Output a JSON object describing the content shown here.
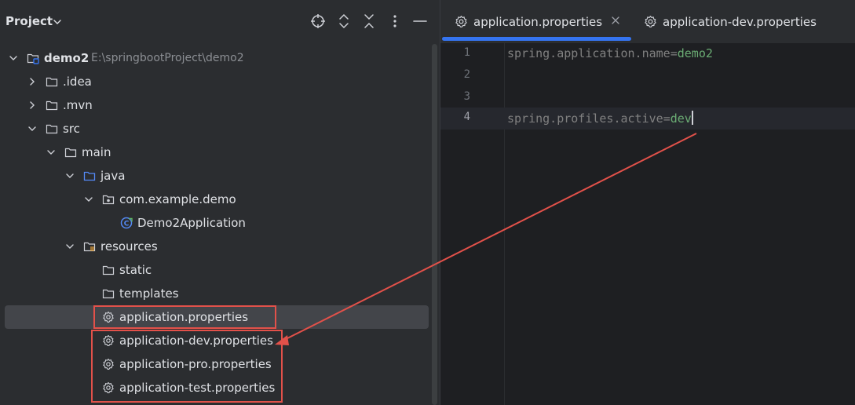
{
  "project_panel": {
    "title": "Project",
    "header_icons": [
      "crosshair-locate-icon",
      "expand-all-icon",
      "collapse-all-icon",
      "more-options-icon",
      "minimize-icon"
    ]
  },
  "tree": [
    {
      "label": "demo2",
      "path": "E:\\springbootProject\\demo2",
      "icon": "module-folder-icon",
      "expanded": true
    },
    {
      "label": ".idea",
      "icon": "folder-icon",
      "expanded": false
    },
    {
      "label": ".mvn",
      "icon": "folder-icon",
      "expanded": false
    },
    {
      "label": "src",
      "icon": "folder-icon",
      "expanded": true
    },
    {
      "label": "main",
      "icon": "folder-icon",
      "expanded": true
    },
    {
      "label": "java",
      "icon": "source-folder-icon",
      "expanded": true
    },
    {
      "label": "com.example.demo",
      "icon": "package-icon",
      "expanded": true
    },
    {
      "label": "Demo2Application",
      "icon": "spring-class-icon"
    },
    {
      "label": "resources",
      "icon": "resources-folder-icon",
      "expanded": true
    },
    {
      "label": "static",
      "icon": "folder-icon"
    },
    {
      "label": "templates",
      "icon": "folder-icon"
    },
    {
      "label": "application.properties",
      "icon": "gear-icon",
      "selected": true
    },
    {
      "label": "application-dev.properties",
      "icon": "gear-icon"
    },
    {
      "label": "application-pro.properties",
      "icon": "gear-icon"
    },
    {
      "label": "application-test.properties",
      "icon": "gear-icon"
    }
  ],
  "editor": {
    "tabs": [
      {
        "label": "application.properties",
        "active": true
      },
      {
        "label": "application-dev.properties",
        "active": false
      }
    ],
    "lines": [
      {
        "num": "1",
        "key": "spring.application.name",
        "op": "=",
        "val": "demo2"
      },
      {
        "num": "2",
        "key": "",
        "op": "",
        "val": ""
      },
      {
        "num": "3",
        "key": "",
        "op": "",
        "val": ""
      },
      {
        "num": "4",
        "key": "spring.profiles.active",
        "op": "=",
        "val": "dev",
        "current": true
      }
    ]
  },
  "colors": {
    "accent": "#3574f0",
    "annotation": "#e2514a",
    "value_green": "#6aab73"
  }
}
